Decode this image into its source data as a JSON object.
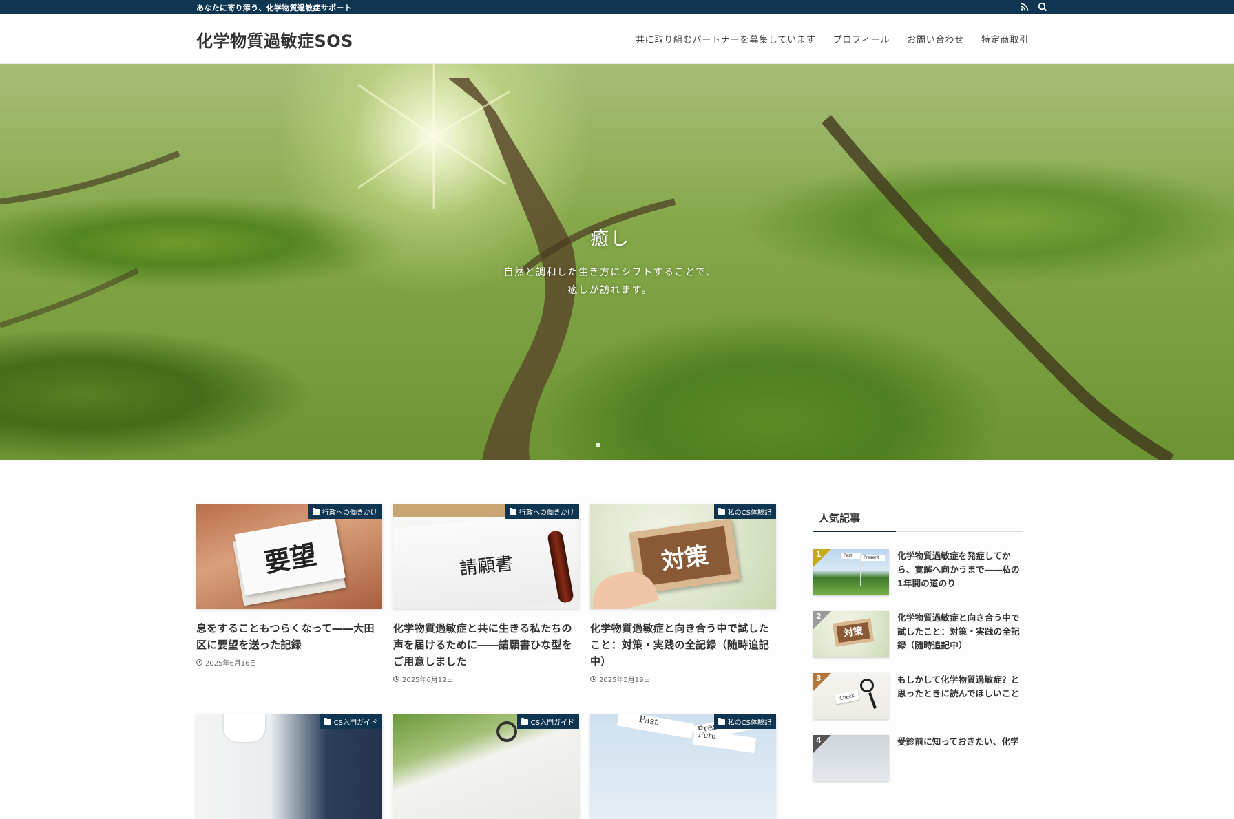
{
  "topbar": {
    "tagline": "あなたに寄り添う、化学物質過敏症サポート",
    "icons": [
      "rss-icon",
      "search-icon"
    ]
  },
  "header": {
    "site_title": "化学物質過敏症SOS",
    "nav": [
      "共に取り組むパートナーを募集しています",
      "プロフィール",
      "お問い合わせ",
      "特定商取引"
    ]
  },
  "hero": {
    "title": "癒し",
    "subtitle_line1": "自然と調和した生き方にシフトすることで、",
    "subtitle_line2": "癒しが訪れます。"
  },
  "posts": [
    {
      "category": "行政への働きかけ",
      "thumb_text": "要望",
      "title": "息をすることもつらくなって――大田区に要望を送った記録",
      "date": "2025年6月16日"
    },
    {
      "category": "行政への働きかけ",
      "thumb_text": "請願書",
      "title": "化学物質過敏症と共に生きる私たちの声を届けるために――請願書ひな型をご用意しました",
      "date": "2025年6月12日"
    },
    {
      "category": "私のCS体験記",
      "thumb_text": "対策",
      "title": "化学物質過敏症と向き合う中で試したこと：対策・実践の全記録（随時追記中）",
      "date": "2025年5月19日"
    },
    {
      "category": "CS入門ガイド"
    },
    {
      "category": "CS入門ガイド"
    },
    {
      "category": "私のCS体験記",
      "thumb_text_1": "Past",
      "thumb_text_2": "Pres",
      "thumb_text_3": "Futu"
    }
  ],
  "sidebar": {
    "title": "人気記事",
    "items": [
      {
        "rank": "1",
        "title": "化学物質過敏症を発症してから、寛解へ向かうまで――私の1年間の道のり",
        "thumb_text_1": "Past",
        "thumb_text_2": "Present"
      },
      {
        "rank": "2",
        "title": "化学物質過敏症と向き合う中で試したこと：対策・実践の全記録（随時追記中）",
        "thumb_text": "対策"
      },
      {
        "rank": "3",
        "title": "もしかして化学物質過敏症？と思ったときに読んでほしいこと",
        "thumb_text": "Check"
      },
      {
        "rank": "4",
        "title": "受診前に知っておきたい、化学"
      }
    ]
  },
  "colors": {
    "brand": "#0f3550",
    "rank1": "#c8a91a",
    "rank2": "#9a9a9a",
    "rank3": "#b5743a",
    "rank4": "#555555"
  }
}
